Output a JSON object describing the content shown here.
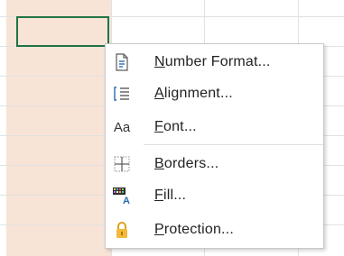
{
  "colors": {
    "shaded_column": "#f8e4d6",
    "selection_border": "#217346",
    "menu_border": "#c8c8c8"
  },
  "context_menu": {
    "items": [
      {
        "icon": "number-format-icon",
        "pre": "",
        "accel": "N",
        "post": "umber Format..."
      },
      {
        "icon": "alignment-icon",
        "pre": "",
        "accel": "A",
        "post": "lignment..."
      },
      {
        "icon": "font-icon",
        "icon_text": "Aa",
        "pre": "",
        "accel": "F",
        "post": "ont..."
      },
      {
        "icon": "borders-icon",
        "pre": "",
        "accel": "B",
        "post": "orders..."
      },
      {
        "icon": "fill-icon",
        "pre": "",
        "accel": "F",
        "post": "ill..."
      },
      {
        "icon": "lock-icon",
        "pre": "",
        "accel": "P",
        "post": "rotection..."
      }
    ]
  }
}
